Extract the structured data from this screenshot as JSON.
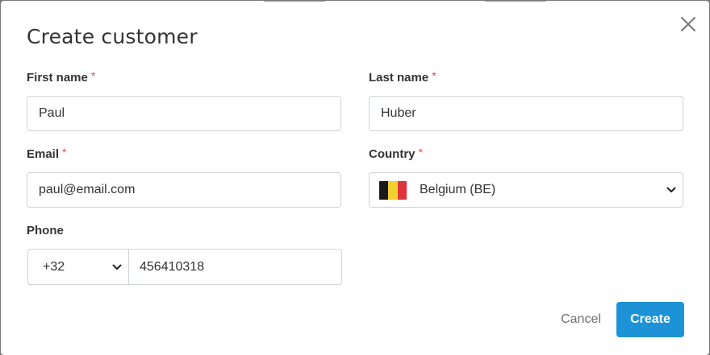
{
  "dialog": {
    "title": "Create customer",
    "close_icon": "close-icon"
  },
  "form": {
    "first_name": {
      "label": "First name",
      "required_mark": "*",
      "value": "Paul"
    },
    "last_name": {
      "label": "Last name",
      "required_mark": "*",
      "value": "Huber"
    },
    "email": {
      "label": "Email",
      "required_mark": "*",
      "value": "paul@email.com"
    },
    "country": {
      "label": "Country",
      "required_mark": "*",
      "selected": "Belgium (BE)",
      "flag_icon": "belgium-flag-icon",
      "flag_colors": [
        "#1a1a1a",
        "#f2d12f",
        "#e0343c"
      ],
      "chevron_icon": "chevron-down-icon"
    },
    "phone": {
      "label": "Phone",
      "country_code": "+32",
      "number": "456410318",
      "chevron_icon": "chevron-down-icon"
    }
  },
  "actions": {
    "cancel_label": "Cancel",
    "create_label": "Create"
  },
  "colors": {
    "primary": "#1e92d6",
    "required": "#e04b4b",
    "border": "#cfd3d7"
  }
}
